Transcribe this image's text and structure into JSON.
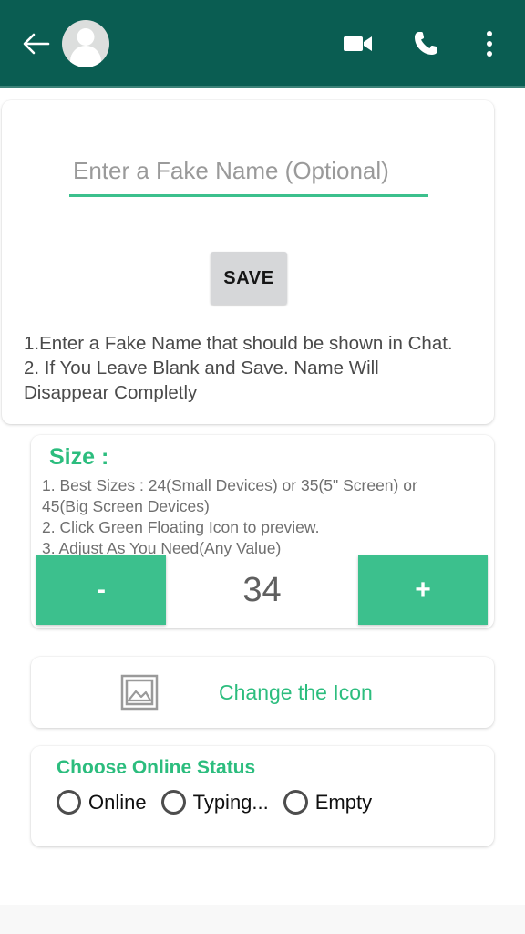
{
  "appbar": {
    "back_icon": "arrow-left-icon",
    "avatar": "default-contact-avatar",
    "video_call_icon": "video-camera-icon",
    "voice_call_icon": "phone-icon",
    "overflow_icon": "three-dots-menu-icon",
    "background_color": "#0a5d52"
  },
  "name_card": {
    "input_placeholder": "Enter a Fake Name (Optional)",
    "input_value": "",
    "underline_color": "#3cc08d",
    "save_label": "SAVE",
    "help_text": "1.Enter a Fake Name that should be shown in Chat.\n2. If You Leave Blank and Save. Name Will\nDisappear Completly"
  },
  "size_card": {
    "title": "Size :",
    "help_text": "1. Best Sizes : 24(Small Devices) or 35(5\" Screen) or\n45(Big Screen Devices)\n 2. Click Green Floating Icon to preview.\n 3. Adjust As You Need(Any Value)",
    "decrement_label": "-",
    "increment_label": "+",
    "value": "34",
    "button_color": "#3cc08d",
    "accent_color": "#2cbd7e"
  },
  "change_icon_card": {
    "icon": "image-picture-icon",
    "label": "Change the Icon",
    "label_color": "#2cbd7e"
  },
  "status_card": {
    "title": "Choose Online Status",
    "title_color": "#2cbd7e",
    "options": [
      {
        "label": "Online",
        "selected": false
      },
      {
        "label": "Typing...",
        "selected": false
      },
      {
        "label": "Empty",
        "selected": false
      }
    ]
  }
}
